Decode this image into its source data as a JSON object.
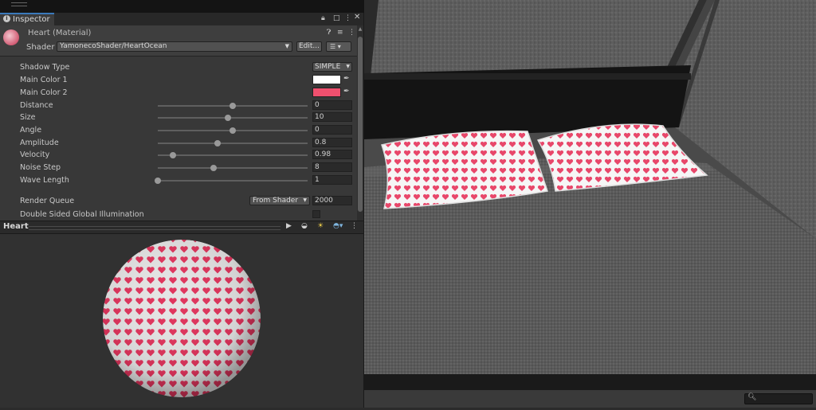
{
  "inspector": {
    "tab_label": "Inspector",
    "material_title": "Heart (Material)",
    "shader_label": "Shader",
    "shader_value": "YamonecoShader/HeartOcean",
    "edit_button": "Edit...",
    "properties": {
      "shadow_type": {
        "label": "Shadow Type",
        "value": "SIMPLE"
      },
      "main_color_1": {
        "label": "Main Color 1",
        "color": "#ffffff"
      },
      "main_color_2": {
        "label": "Main Color 2",
        "color": "#f0506e"
      },
      "distance": {
        "label": "Distance",
        "value": "0",
        "level": 0.5
      },
      "size": {
        "label": "Size",
        "value": "10",
        "level": 0.47
      },
      "angle": {
        "label": "Angle",
        "value": "0",
        "level": 0.5
      },
      "amplitude": {
        "label": "Amplitude",
        "value": "0.8",
        "level": 0.4
      },
      "velocity": {
        "label": "Velocity",
        "value": "0.98",
        "level": 0.1
      },
      "noise_step": {
        "label": "Noise Step",
        "value": "8",
        "level": 0.37
      },
      "wave_length": {
        "label": "Wave Length",
        "value": "1",
        "level": 0.0
      },
      "render_queue": {
        "label": "Render Queue",
        "mode": "From Shader",
        "value": "2000"
      },
      "double_sided_gi": {
        "label": "Double Sided Global Illumination",
        "checked": false
      }
    }
  },
  "preview": {
    "title": "Heart"
  },
  "colors": {
    "accent_tab": "#3a79bb",
    "heart_pink": "#e8476a",
    "panel_bg": "#383838"
  },
  "icons": [
    "info-icon",
    "lock-icon",
    "maximize-icon",
    "more-icon",
    "help-icon",
    "settings-sliders-icon",
    "kebab-icon",
    "eyedropper-icon",
    "play-icon",
    "sphere-icon",
    "light-icon",
    "sphere-color-icon",
    "search-icon"
  ]
}
